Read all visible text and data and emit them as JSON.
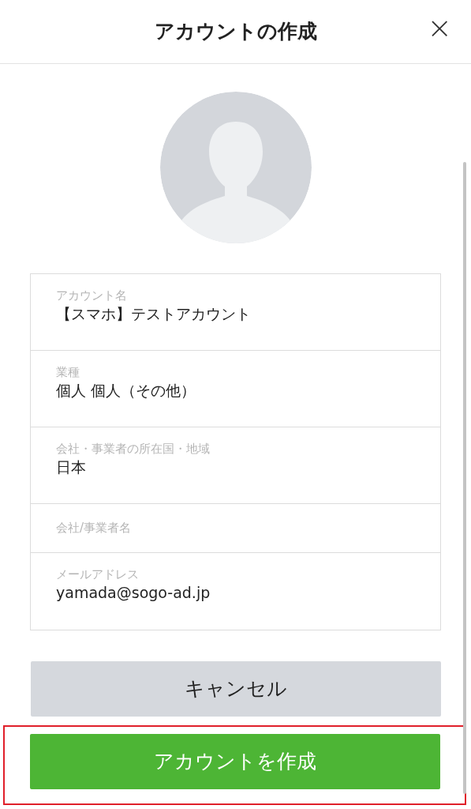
{
  "header": {
    "title": "アカウントの作成",
    "close": "×"
  },
  "fields": [
    {
      "label": "アカウント名",
      "value": "【スマホ】テストアカウント"
    },
    {
      "label": "業種",
      "value": "個人 個人（その他）"
    },
    {
      "label": "会社・事業者の所在国・地域",
      "value": "日本"
    },
    {
      "placeholder": "会社/事業者名"
    },
    {
      "label": "メールアドレス",
      "value": "yamada@sogo-ad.jp"
    }
  ],
  "buttons": [
    {
      "label": "キャンセル",
      "kind": "secondary",
      "highlighted": false
    },
    {
      "label": "アカウントを作成",
      "kind": "primary",
      "highlighted": true
    }
  ]
}
